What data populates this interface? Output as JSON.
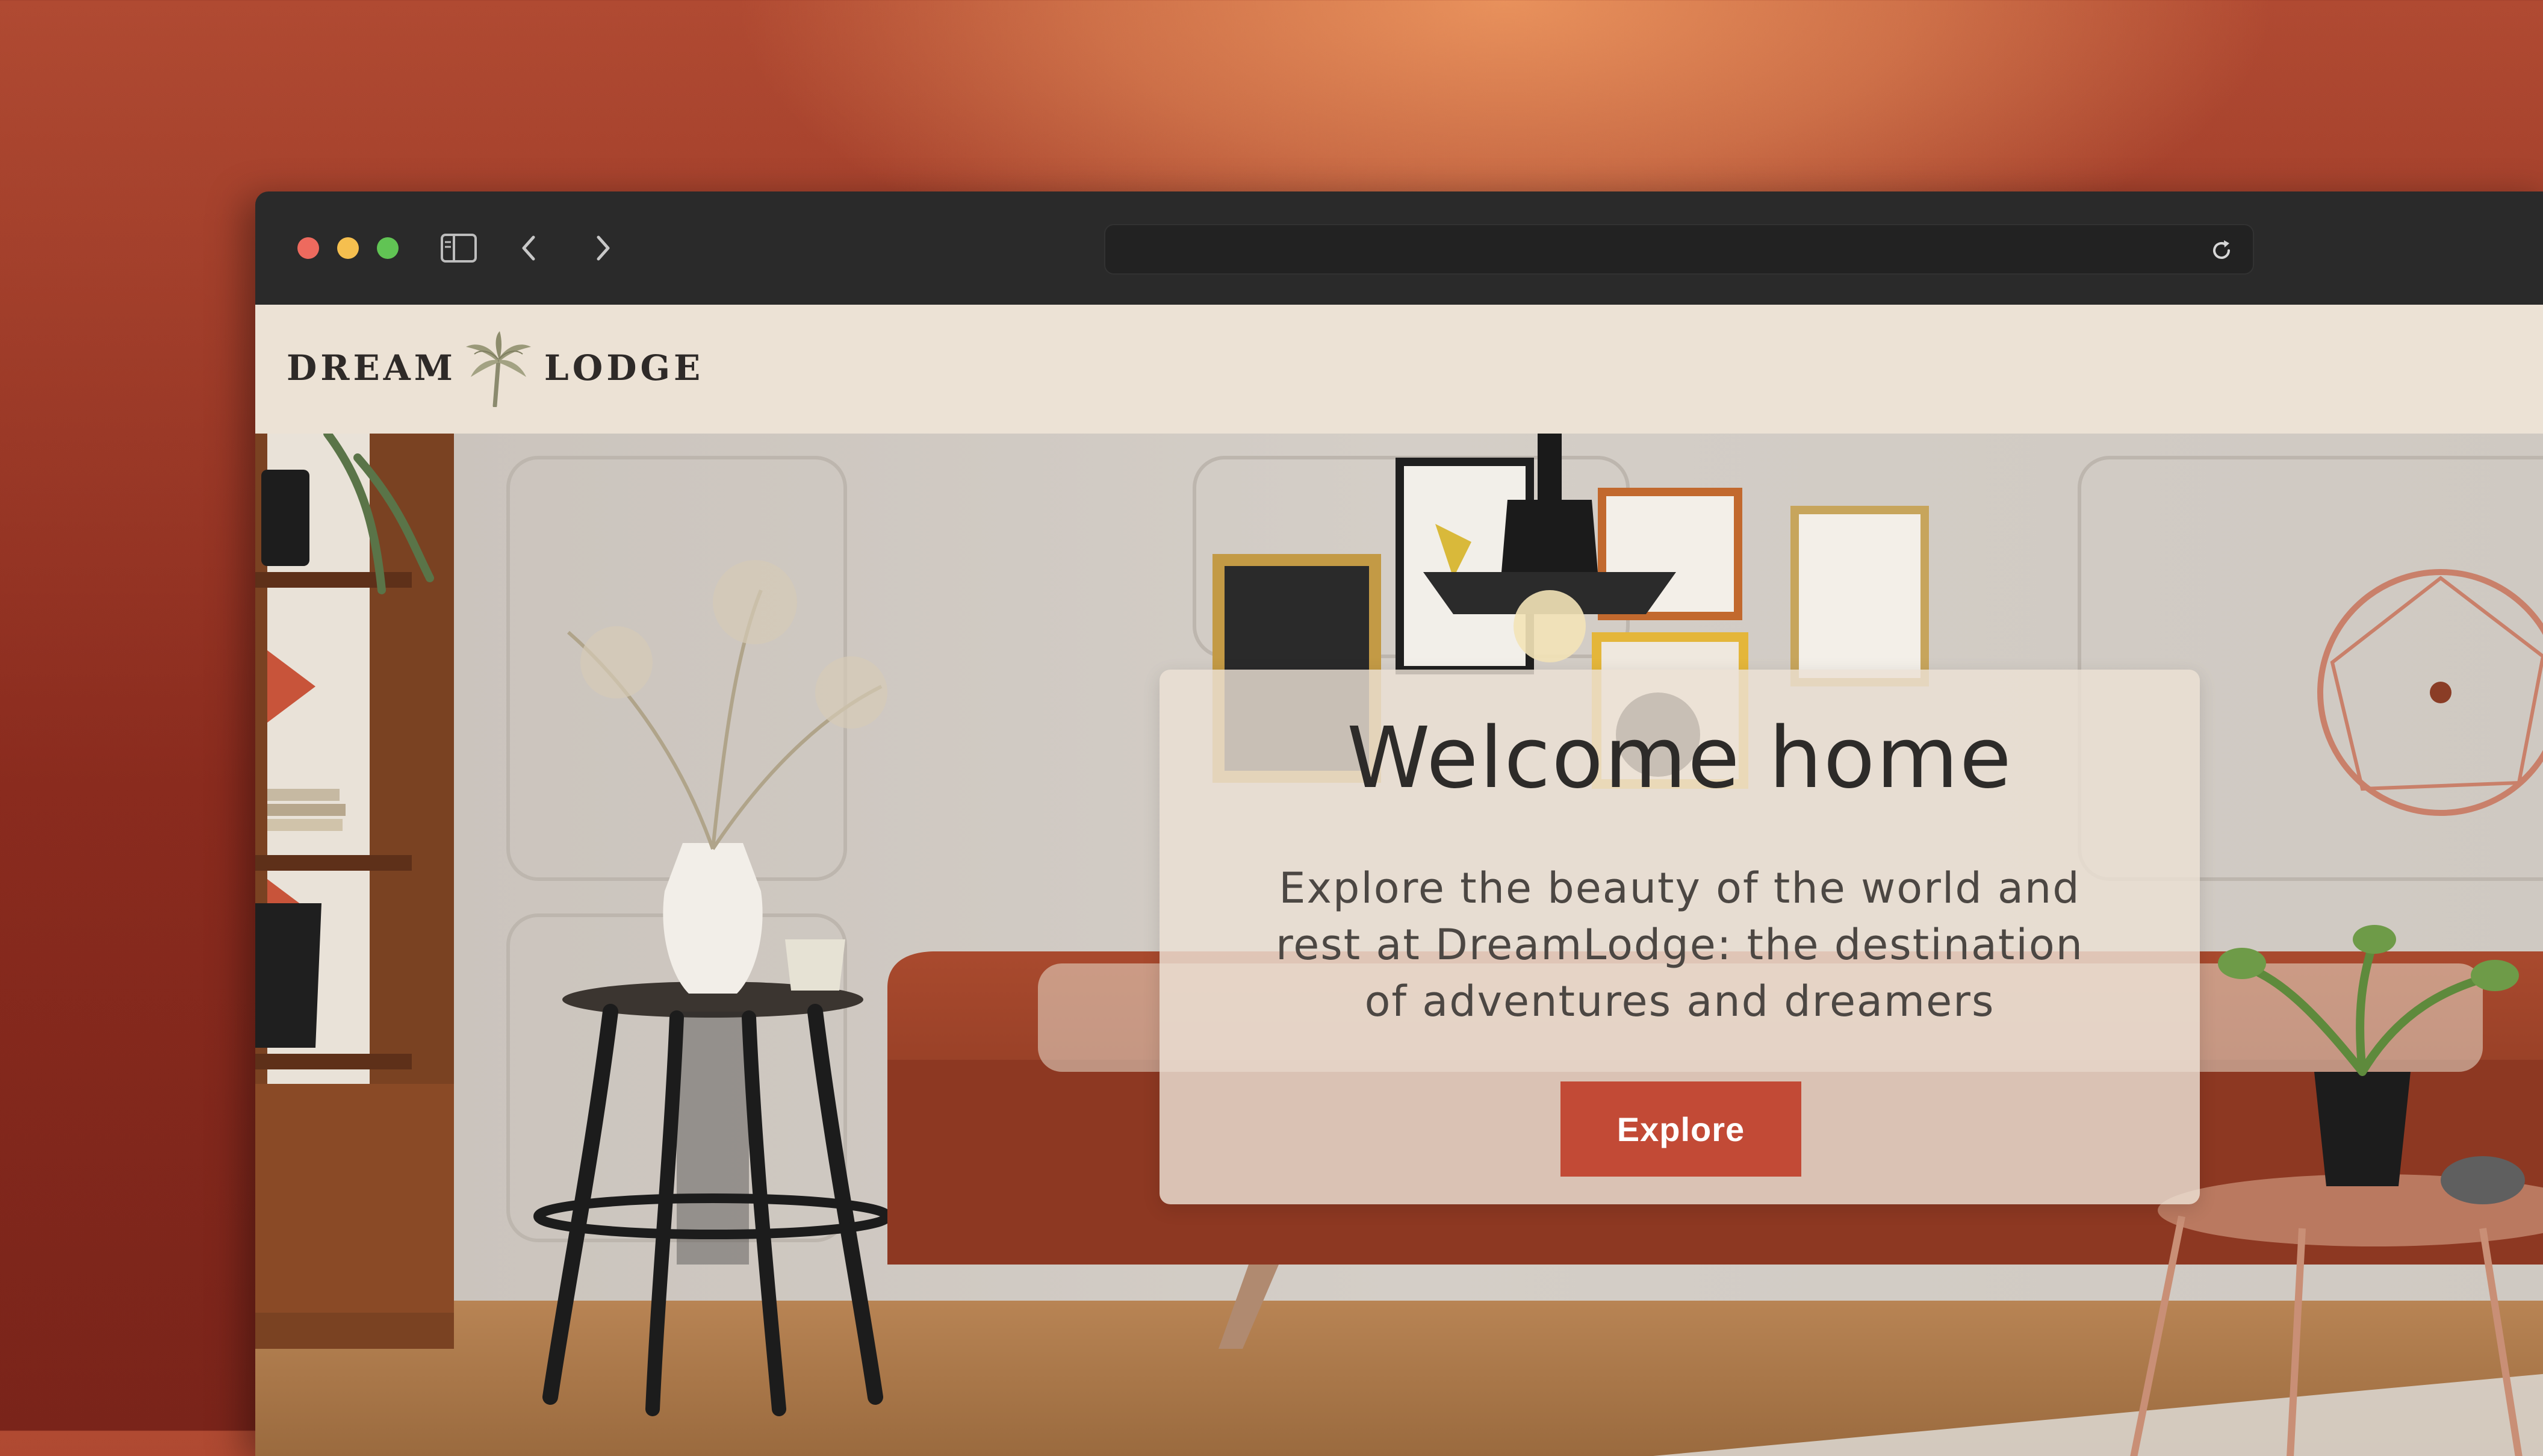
{
  "browser": {
    "icons": {
      "sidebar": "sidebar-icon",
      "back": "chevron-left-icon",
      "forward": "chevron-right-icon",
      "reload": "reload-icon"
    },
    "address_value": ""
  },
  "site": {
    "logo": {
      "left_word": "DREAM",
      "right_word": "LODGE",
      "icon": "palm-tree-icon"
    }
  },
  "hero": {
    "title": "Welcome home",
    "subtitle": "Explore the beauty of the world and rest at DreamLodge: the destination of adventures and dreamers",
    "cta_label": "Explore"
  },
  "colors": {
    "accent": "#c24a36",
    "chrome": "#2a2a2a",
    "header_bg": "#ece2d5",
    "background_orange": "#e8915c",
    "background_red": "#8a2b1e"
  }
}
